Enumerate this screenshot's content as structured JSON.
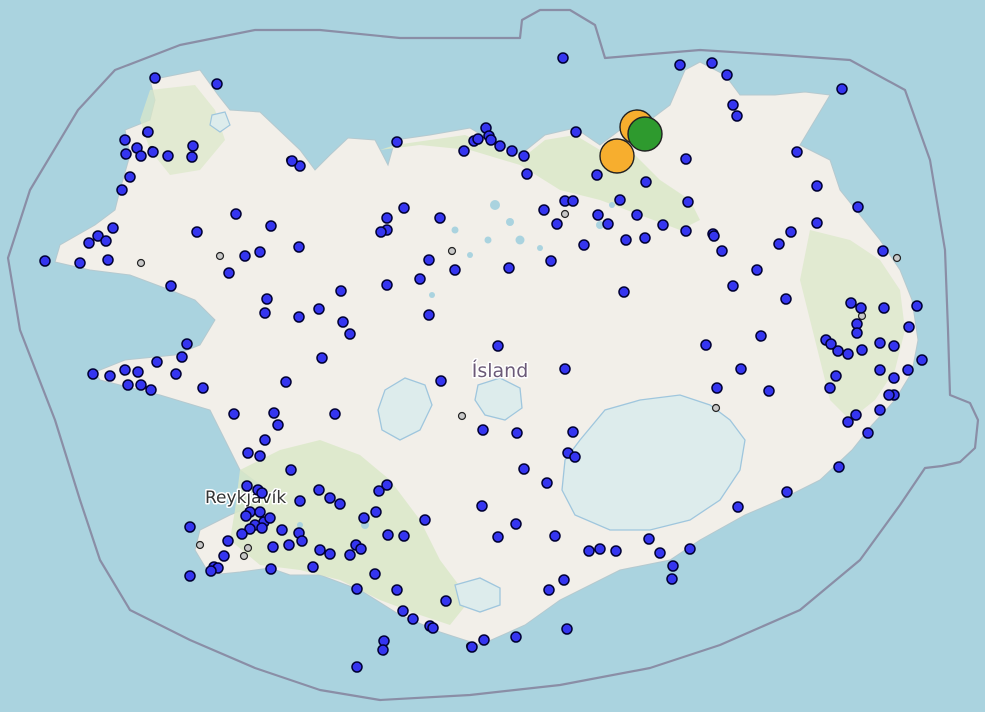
{
  "map": {
    "labels": {
      "country": "Ísland",
      "city": "Reykjavík"
    },
    "colors": {
      "sea": "#aad3df",
      "land": "#f2efe9",
      "land_green": "#dbe8c8",
      "glacier": "#ddecec",
      "glacier_outline": "#9fc6dd",
      "boundary": "#8a8ea6",
      "station_fill": "#3535f0",
      "station_stroke": "#000033",
      "inactive_fill": "#c8c8c8",
      "highlight_orange": "#f7ae2e",
      "highlight_green": "#2e9a2e"
    },
    "legend": {
      "station": "blue-circle-marker",
      "inactive_station": "gray-circle-marker",
      "highlight": "orange-green-circle-markers"
    }
  }
}
